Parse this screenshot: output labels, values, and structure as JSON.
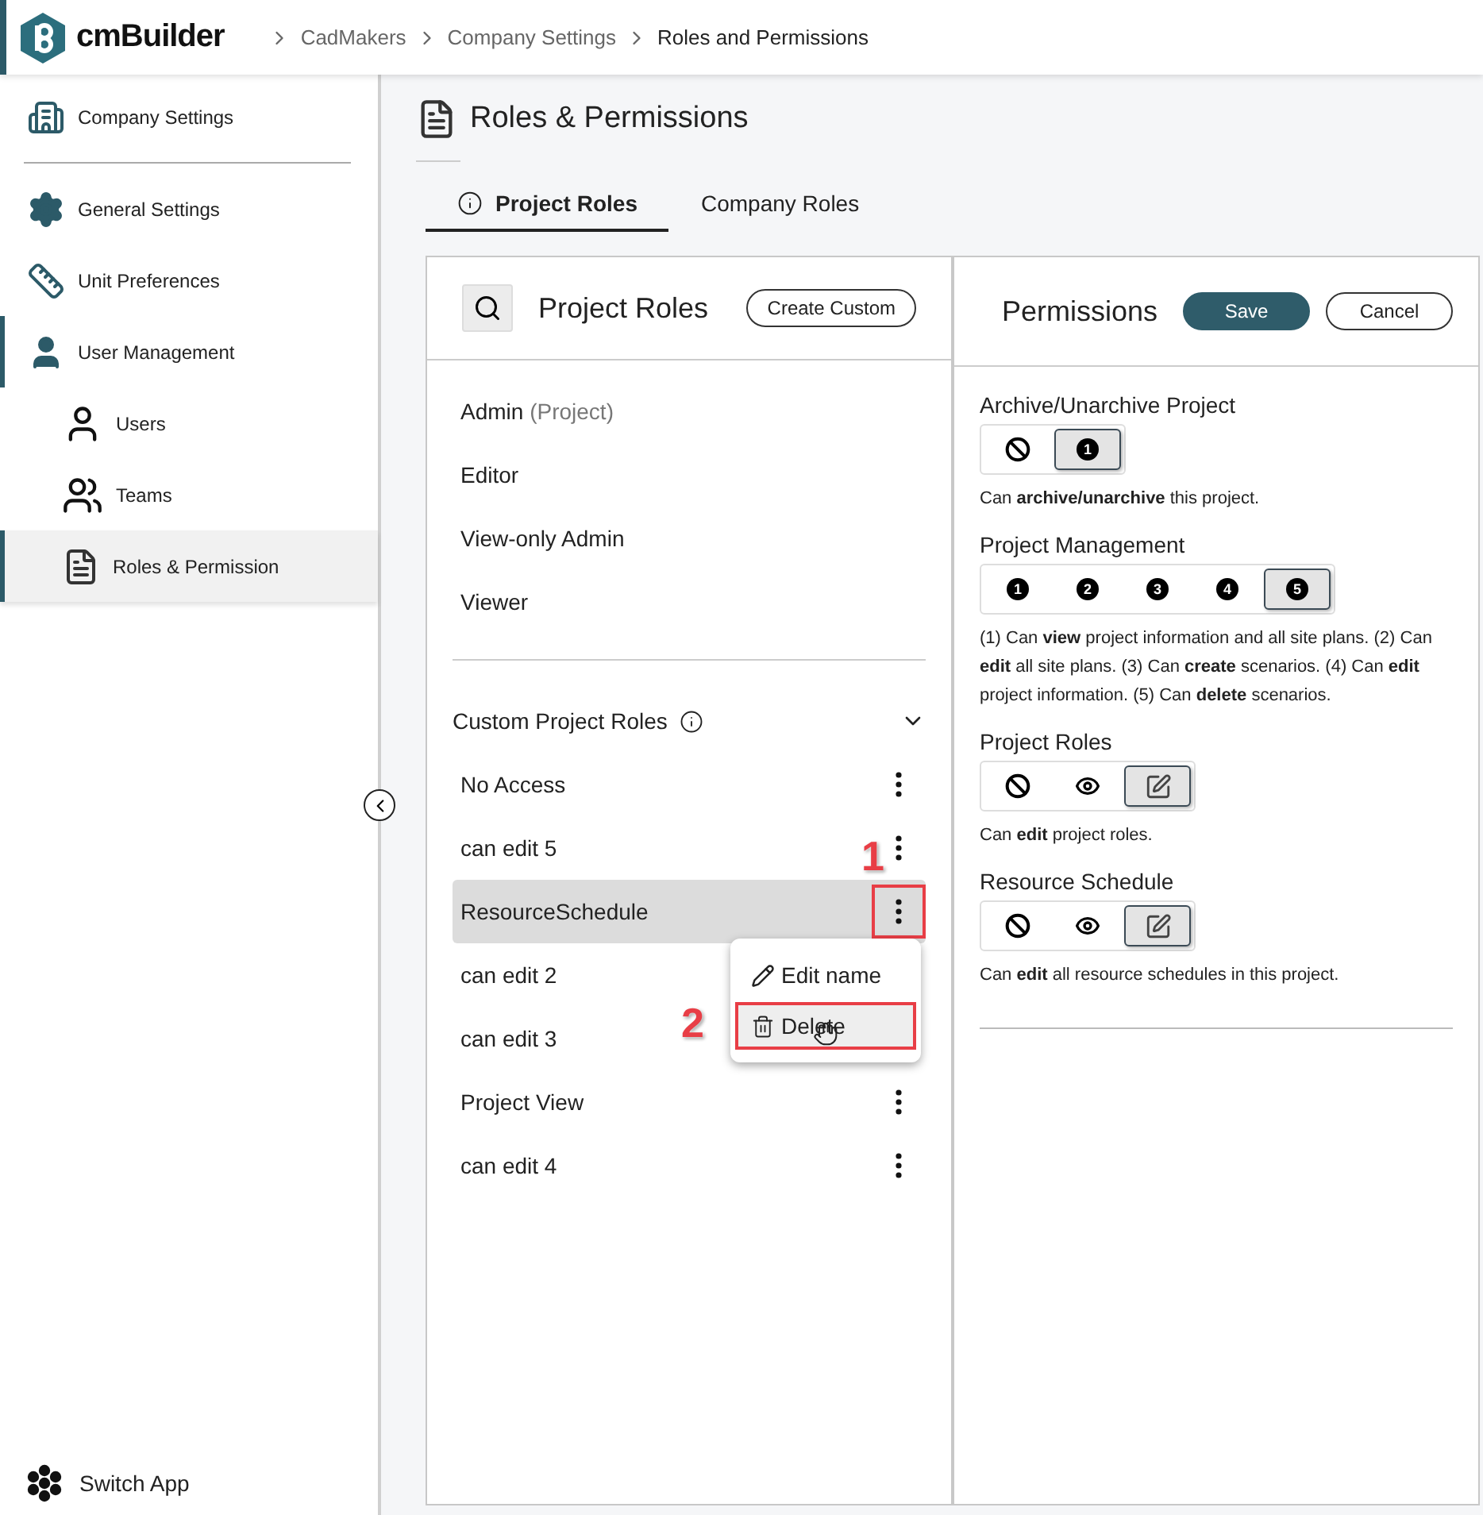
{
  "header": {
    "brand": "cmBuilder",
    "breadcrumbs": [
      {
        "label": "CadMakers",
        "current": false
      },
      {
        "label": "Company Settings",
        "current": false
      },
      {
        "label": "Roles and Permissions",
        "current": true
      }
    ]
  },
  "sidebar": {
    "items": [
      {
        "label": "Company Settings",
        "kind": "header",
        "selected": false,
        "expanded": false
      },
      {
        "label": "General Settings",
        "kind": "item",
        "selected": false,
        "expanded": false
      },
      {
        "label": "Unit Preferences",
        "kind": "item",
        "selected": false,
        "expanded": false
      },
      {
        "label": "User Management",
        "kind": "item",
        "selected": false,
        "expanded": true,
        "children": [
          {
            "label": "Users",
            "selected": false
          },
          {
            "label": "Teams",
            "selected": false
          },
          {
            "label": "Roles & Permission",
            "selected": true
          }
        ]
      }
    ],
    "footer": "Switch App"
  },
  "page": {
    "title": "Roles & Permissions"
  },
  "tabs": [
    {
      "label": "Project Roles",
      "selected": true
    },
    {
      "label": "Company Roles",
      "selected": false
    }
  ],
  "roles_panel": {
    "title": "Project Roles",
    "create_button": "Create Custom",
    "roles": [
      {
        "name": "Admin",
        "note": "(Project)"
      },
      {
        "name": "Editor"
      },
      {
        "name": "View-only Admin"
      },
      {
        "name": "Viewer"
      }
    ],
    "custom_title": "Custom Project Roles",
    "custom_expanded": true,
    "custom_roles": [
      {
        "name": "No Access",
        "selected": false
      },
      {
        "name": "can edit 5",
        "selected": false
      },
      {
        "name": "ResourceSchedule",
        "selected": true,
        "callout": "1",
        "menu": [
          {
            "label": "Edit name"
          },
          {
            "label": "Delete",
            "callout": "2"
          }
        ]
      },
      {
        "name": "can edit 2",
        "selected": false
      },
      {
        "name": "can edit 3",
        "selected": false
      },
      {
        "name": "Project View",
        "selected": false
      },
      {
        "name": "can edit 4",
        "selected": false
      }
    ]
  },
  "permissions_panel": {
    "title": "Permissions",
    "save": "Save",
    "cancel": "Cancel",
    "sections": [
      {
        "title": "Archive/Unarchive Project",
        "options": [
          {
            "kind": "none",
            "selected": false
          },
          {
            "kind": "level",
            "label": "1",
            "selected": true
          }
        ],
        "description": "Can **archive/unarchive** this project."
      },
      {
        "title": "Project Management",
        "options": [
          {
            "kind": "level",
            "label": "1",
            "selected": false
          },
          {
            "kind": "level",
            "label": "2",
            "selected": false
          },
          {
            "kind": "level",
            "label": "3",
            "selected": false
          },
          {
            "kind": "level",
            "label": "4",
            "selected": false
          },
          {
            "kind": "level",
            "label": "5",
            "selected": true
          }
        ],
        "description": "(1) Can **view** project information and all site plans. (2) Can **edit** all site plans. (3) Can **create** scenarios. (4) Can **edit** project information. (5) Can **delete** scenarios."
      },
      {
        "title": "Project Roles",
        "options": [
          {
            "kind": "none",
            "selected": false
          },
          {
            "kind": "view",
            "selected": false
          },
          {
            "kind": "edit",
            "selected": true
          }
        ],
        "description": "Can **edit** project roles."
      },
      {
        "title": "Resource Schedule",
        "options": [
          {
            "kind": "none",
            "selected": false
          },
          {
            "kind": "view",
            "selected": false
          },
          {
            "kind": "edit",
            "selected": true
          }
        ],
        "description": "Can **edit** all resource schedules in this project."
      }
    ]
  }
}
